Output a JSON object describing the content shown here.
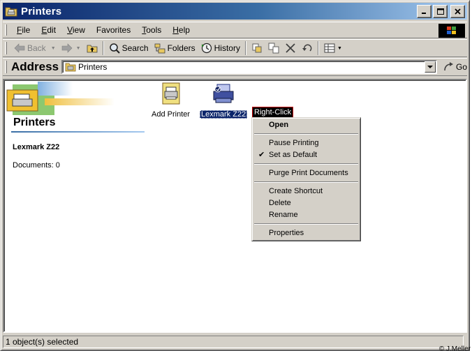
{
  "window": {
    "title": "Printers"
  },
  "menubar": {
    "items": [
      {
        "label": "File",
        "key": "F",
        "rest": "ile"
      },
      {
        "label": "Edit",
        "key": "E",
        "rest": "dit"
      },
      {
        "label": "View",
        "key": "V",
        "rest": "iew"
      },
      {
        "label": "Favorites",
        "key": "",
        "rest": "Favorites"
      },
      {
        "label": "Tools",
        "key": "T",
        "rest": "ools"
      },
      {
        "label": "Help",
        "key": "H",
        "rest": "elp"
      }
    ]
  },
  "toolbar": {
    "back_label": "Back",
    "search_label": "Search",
    "folders_label": "Folders",
    "history_label": "History"
  },
  "address": {
    "label": "Address",
    "value": "Printers",
    "go_label": "Go"
  },
  "left_panel": {
    "title": "Printers",
    "selected_name": "Lexmark Z22",
    "documents": "Documents: 0"
  },
  "icons": [
    {
      "name": "Add Printer"
    },
    {
      "name": "Lexmark Z22"
    }
  ],
  "callout": "Right-Click",
  "context_menu": {
    "open": "Open",
    "pause": "Pause Printing",
    "default": "Set as Default",
    "purge": "Purge Print Documents",
    "shortcut": "Create Shortcut",
    "delete": "Delete",
    "rename": "Rename",
    "properties": "Properties"
  },
  "status": {
    "text": "1 object(s) selected"
  },
  "credit": "© J.Meller",
  "colors": {
    "title_active": "#0a246a",
    "selection": "#0a246a",
    "face": "#d4d0c8"
  }
}
